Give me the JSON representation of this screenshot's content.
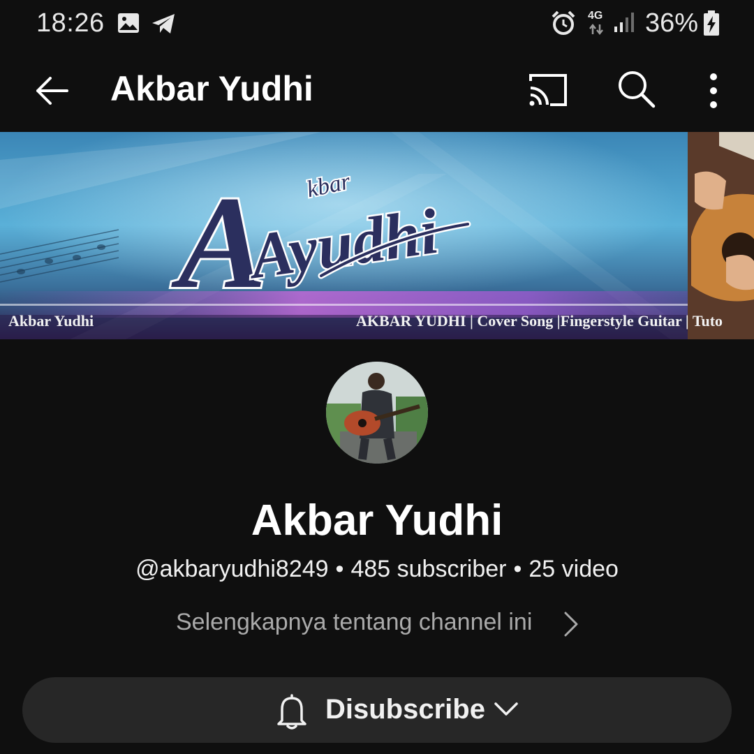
{
  "status_bar": {
    "time": "18:26",
    "network": "4G",
    "battery": "36%",
    "icons": [
      "gallery-icon",
      "telegram-icon",
      "alarm-icon",
      "network-4g-icon",
      "signal-icon",
      "battery-charging-icon"
    ]
  },
  "app_bar": {
    "title": "Akbar Yudhi",
    "icons": [
      "back-arrow-icon",
      "cast-icon",
      "search-icon",
      "more-vert-icon"
    ]
  },
  "banner": {
    "logo_text_small": "kbar",
    "logo_text_large": "Ayudhi",
    "name_text": "Akbar Yudhi",
    "tagline": "AKBAR YUDHI | Cover Song |Fingerstyle Guitar | Tuto"
  },
  "channel": {
    "name": "Akbar Yudhi",
    "handle": "@akbaryudhi8249",
    "separator": "•",
    "subscribers": "485 subscriber",
    "videos": "25 video",
    "about_link": "Selengkapnya tentang channel ini"
  },
  "subscribe_button": {
    "label": "Disubscribe",
    "icons": [
      "bell-icon",
      "chevron-down-icon"
    ]
  },
  "colors": {
    "background": "#0f0f0f",
    "button_background": "#272727",
    "text_primary": "#f1f1f1",
    "text_secondary": "#aaaaaa"
  }
}
